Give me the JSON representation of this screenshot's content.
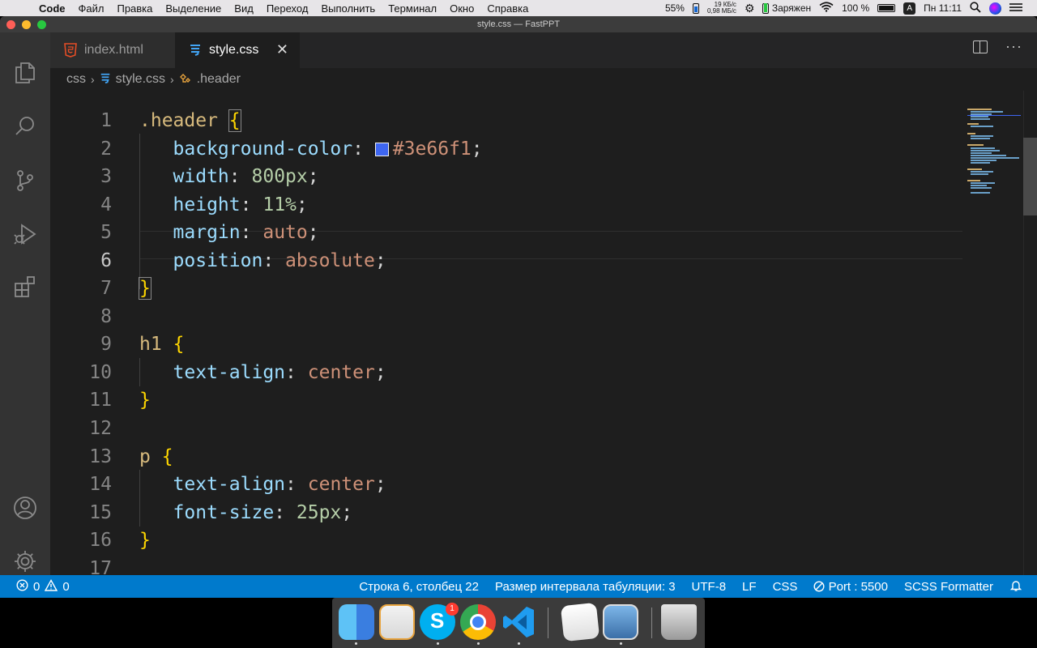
{
  "menubar": {
    "app": "Code",
    "items": [
      "Файл",
      "Правка",
      "Выделение",
      "Вид",
      "Переход",
      "Выполнить",
      "Терминал",
      "Окно",
      "Справка"
    ],
    "battery_small_pct": "55%",
    "net_up": "19 КБ/с",
    "net_down": "0,98 МБ/с",
    "charge_status": "Заряжен",
    "battery_pct": "100 %",
    "input_lang": "A",
    "clock": "Пн 11:11"
  },
  "window": {
    "title": "style.css — FastPPT"
  },
  "tabs": [
    {
      "label": "index.html",
      "icon": "html5-icon",
      "active": false
    },
    {
      "label": "style.css",
      "icon": "css-icon",
      "active": true,
      "close": "✕"
    }
  ],
  "breadcrumb": {
    "folder": "css",
    "file": "style.css",
    "symbol": ".header"
  },
  "editor": {
    "line_numbers": [
      "1",
      "2",
      "3",
      "4",
      "5",
      "6",
      "7",
      "8",
      "9",
      "10",
      "11",
      "12",
      "13",
      "14",
      "15",
      "16",
      "17"
    ],
    "active_line": "6",
    "swatch_color": "#3e66f1",
    "tokens": {
      "l1_sel": ".header",
      "l1_brace": "{",
      "l2_prop": "background-color",
      "l2_val": "#3e66f1",
      "l3_prop": "width",
      "l3_val": "800px",
      "l4_prop": "height",
      "l4_val": "11%",
      "l5_prop": "margin",
      "l5_val": "auto",
      "l6_prop": "position",
      "l6_val": "absolute",
      "l7_brace": "}",
      "l9_sel": "h1",
      "l9_brace": "{",
      "l10_prop": "text-align",
      "l10_val": "center",
      "l11_brace": "}",
      "l13_sel": "p",
      "l13_brace": "{",
      "l14_prop": "text-align",
      "l14_val": "center",
      "l15_prop": "font-size",
      "l15_val": "25px",
      "l16_brace": "}",
      "colon": ":",
      "semi": ";"
    }
  },
  "statusbar": {
    "errors": "0",
    "warnings": "0",
    "position": "Строка 6, столбец 22",
    "indent": "Размер интервала табуляции: 3",
    "encoding": "UTF-8",
    "eol": "LF",
    "language": "CSS",
    "port": "Port : 5500",
    "formatter": "SCSS Formatter"
  },
  "dock": {
    "apps": [
      "finder",
      "pages",
      "skype",
      "chrome",
      "vscode",
      "textedit",
      "preview",
      "trash"
    ],
    "skype_badge": "1"
  },
  "colors": {
    "accent": "#007acc",
    "editor_bg": "#1e1e1e",
    "selector": "#d7ba7d",
    "property": "#9cdcfe",
    "number": "#b5cea8",
    "string_value": "#ce9178",
    "brace": "#ffd700"
  }
}
